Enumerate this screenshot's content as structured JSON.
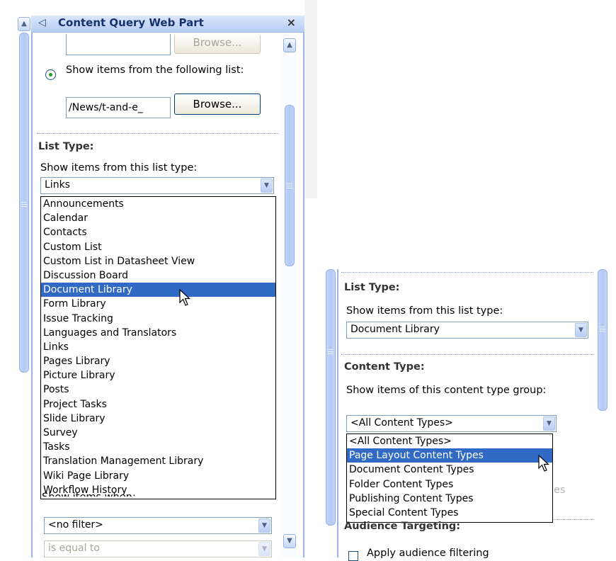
{
  "left_panel": {
    "title": "Content Query Web Part",
    "close_glyph": "×",
    "collapse_glyph": "◁",
    "source_input_value": "",
    "browse_label": "Browse...",
    "radio_label": "Show items from the following list:",
    "list_path_value": "/News/t-and-e_",
    "list_type_title": "List Type:",
    "list_type_label": "Show items from this list type:",
    "list_type_selected": "Links",
    "list_type_options": [
      "Announcements",
      "Calendar",
      "Contacts",
      "Custom List",
      "Custom List in Datasheet View",
      "Discussion Board",
      "Document Library",
      "Form Library",
      "Issue Tracking",
      "Languages and Translators",
      "Links",
      "Pages Library",
      "Picture Library",
      "Posts",
      "Project Tasks",
      "Slide Library",
      "Survey",
      "Tasks",
      "Translation Management Library",
      "Wiki Page Library",
      "Workflow History"
    ],
    "highlighted_option": "Document Library",
    "show_items_when_label": "Show items when:",
    "filter_selected": "<no filter>",
    "operator_selected": "is equal to"
  },
  "right_panel": {
    "list_type_title": "List Type:",
    "list_type_label": "Show items from this list type:",
    "list_type_selected": "Document Library",
    "content_type_title": "Content Type:",
    "content_type_label": "Show items of this content type group:",
    "content_type_selected": "<All Content Types>",
    "content_type_options": [
      "<All Content Types>",
      "Page Layout Content Types",
      "Document Content Types",
      "Folder Content Types",
      "Publishing Content Types",
      "Special Content Types"
    ],
    "highlighted_option": "Page Layout Content Types",
    "hidden_text_fragment": "es",
    "audience_title": "Audience Targeting:",
    "audience_checkbox_label": "Apply audience filtering"
  },
  "colors": {
    "accent": "#316ac5",
    "panel_border": "#9ab5e7",
    "title_bar_top": "#dbe6fb",
    "title_bar_bottom": "#b7cdf4"
  }
}
